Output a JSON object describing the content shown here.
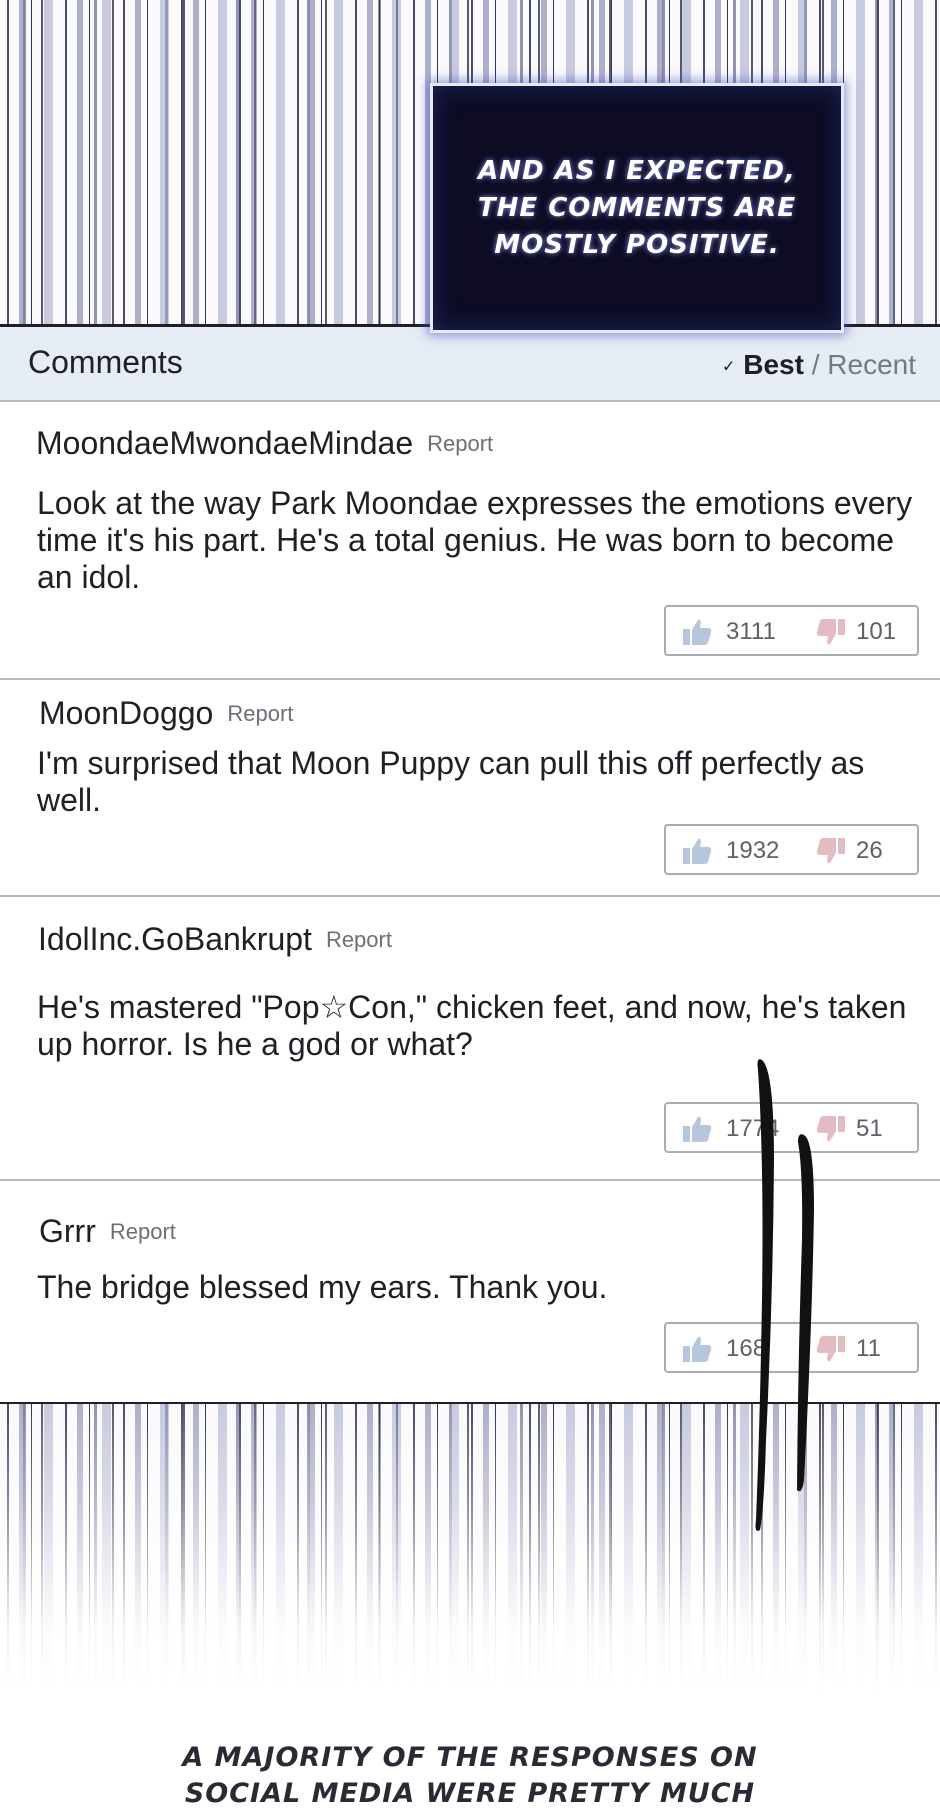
{
  "caption_top": "AND AS I EXPECTED,\nTHE COMMENTS ARE\nMOSTLY POSITIVE.",
  "comments_header": {
    "title": "Comments",
    "sort_best": "Best",
    "sort_separator": "/",
    "sort_recent": "Recent"
  },
  "comments": [
    {
      "author": "MoondaeMwondaeMindae",
      "report": "Report",
      "text": "Look at the way Park Moondae expresses the emotions every time it's his part. He's a total genius. He was born to become an idol.",
      "likes": "3111",
      "dislikes": "101"
    },
    {
      "author": "MoonDoggo",
      "report": "Report",
      "text": "I'm surprised that Moon Puppy can pull this off perfectly as well.",
      "likes": "1932",
      "dislikes": "26"
    },
    {
      "author": "IdolInc.GoBankrupt",
      "report": "Report",
      "text": "He's mastered \"Pop☆Con,\" chicken feet, and now, he's taken up horror. Is he a god or what?",
      "likes": "1774",
      "dislikes": "51"
    },
    {
      "author": "Grrr",
      "report": "Report",
      "text": "The bridge blessed my ears. Thank you.",
      "likes": "168",
      "dislikes": "11"
    }
  ],
  "caption_bottom": "A MAJORITY OF THE RESPONSES ON\nSOCIAL MEDIA WERE PRETTY MUCH",
  "colors": {
    "header_bg": "#e6ecf3",
    "like_icon": "#b7c7db",
    "dislike_icon": "#e3bcc1",
    "caption_bg": "#0d0c24"
  },
  "icons": {
    "like": "thumbs-up-icon",
    "dislike": "thumbs-down-icon",
    "sort": "check-icon"
  }
}
